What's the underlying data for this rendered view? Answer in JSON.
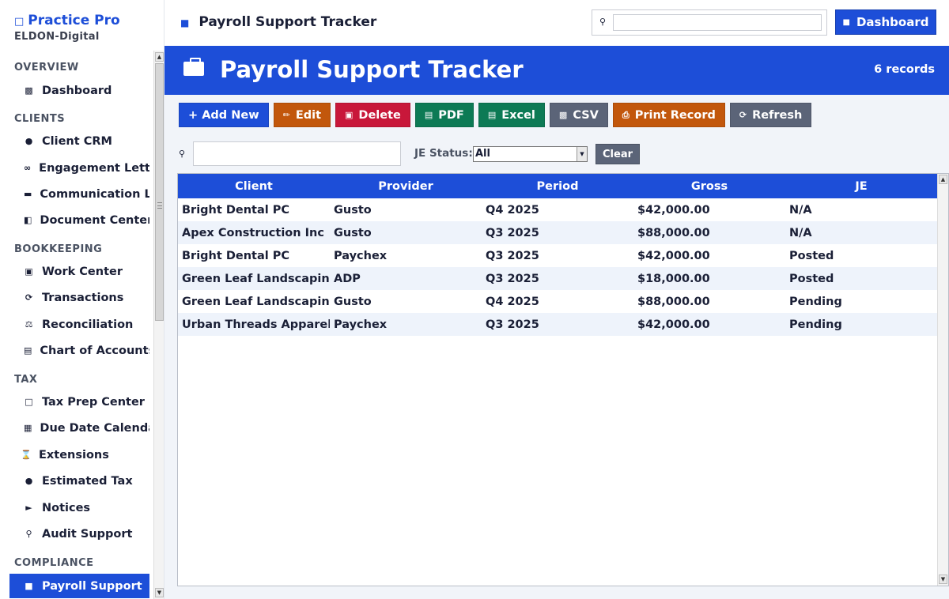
{
  "sidebar": {
    "brand": "Practice Pro",
    "org": "ELDON-Digital",
    "sections": {
      "overview": "OVERVIEW",
      "clients": "CLIENTS",
      "bookkeeping": "BOOKKEEPING",
      "tax": "TAX",
      "compliance": "COMPLIANCE"
    },
    "items": [
      {
        "label": "Dashboard",
        "icon": "bar-chart-icon"
      },
      {
        "label": "Client CRM",
        "icon": "users-icon"
      },
      {
        "label": "Engagement Lette",
        "icon": "link-icon"
      },
      {
        "label": "Communication Lo",
        "icon": "chat-icon"
      },
      {
        "label": "Document Center",
        "icon": "folder-icon"
      },
      {
        "label": "Work Center",
        "icon": "clipboard-icon"
      },
      {
        "label": "Transactions",
        "icon": "refresh-icon"
      },
      {
        "label": "Reconciliation",
        "icon": "scales-icon"
      },
      {
        "label": "Chart of Accounts",
        "icon": "ledger-icon"
      },
      {
        "label": "Tax Prep Center",
        "icon": "document-icon"
      },
      {
        "label": "Due Date Calenda",
        "icon": "calendar-icon"
      },
      {
        "label": "Extensions",
        "icon": "hourglass-icon"
      },
      {
        "label": "Estimated Tax",
        "icon": "money-bag-icon"
      },
      {
        "label": "Notices",
        "icon": "megaphone-icon"
      },
      {
        "label": "Audit Support",
        "icon": "search-icon"
      },
      {
        "label": "Payroll Support",
        "icon": "briefcase-icon"
      }
    ]
  },
  "topbar": {
    "title": "Payroll Support Tracker",
    "search_placeholder": "",
    "dashboard_label": "Dashboard"
  },
  "hero": {
    "title": "Payroll Support Tracker",
    "count": "6 records"
  },
  "toolbar": {
    "add": "+ Add New",
    "edit": "Edit",
    "delete": "Delete",
    "pdf": "PDF",
    "excel": "Excel",
    "csv": "CSV",
    "print": "Print Record",
    "refresh": "Refresh"
  },
  "filter": {
    "search_value": "",
    "je_label": "JE Status:",
    "je_value": "All",
    "clear": "Clear"
  },
  "table": {
    "columns": [
      "Client",
      "Provider",
      "Period",
      "Gross",
      "JE"
    ],
    "rows": [
      [
        "Bright Dental PC",
        "Gusto",
        "Q4 2025",
        "$42,000.00",
        "N/A"
      ],
      [
        "Apex Construction Inc",
        "Gusto",
        "Q3 2025",
        "$88,000.00",
        "N/A"
      ],
      [
        "Bright Dental PC",
        "Paychex",
        "Q3 2025",
        "$42,000.00",
        "Posted"
      ],
      [
        "Green Leaf Landscaping",
        "ADP",
        "Q3 2025",
        "$18,000.00",
        "Posted"
      ],
      [
        "Green Leaf Landscaping",
        "Gusto",
        "Q4 2025",
        "$88,000.00",
        "Pending"
      ],
      [
        "Urban Threads Apparel",
        "Paychex",
        "Q3 2025",
        "$42,000.00",
        "Pending"
      ]
    ]
  },
  "colors": {
    "accent": "#1d4ed8",
    "orange": "#c2570c",
    "red": "#c8173a",
    "green": "#0d7a55",
    "gray": "#5b6478"
  }
}
